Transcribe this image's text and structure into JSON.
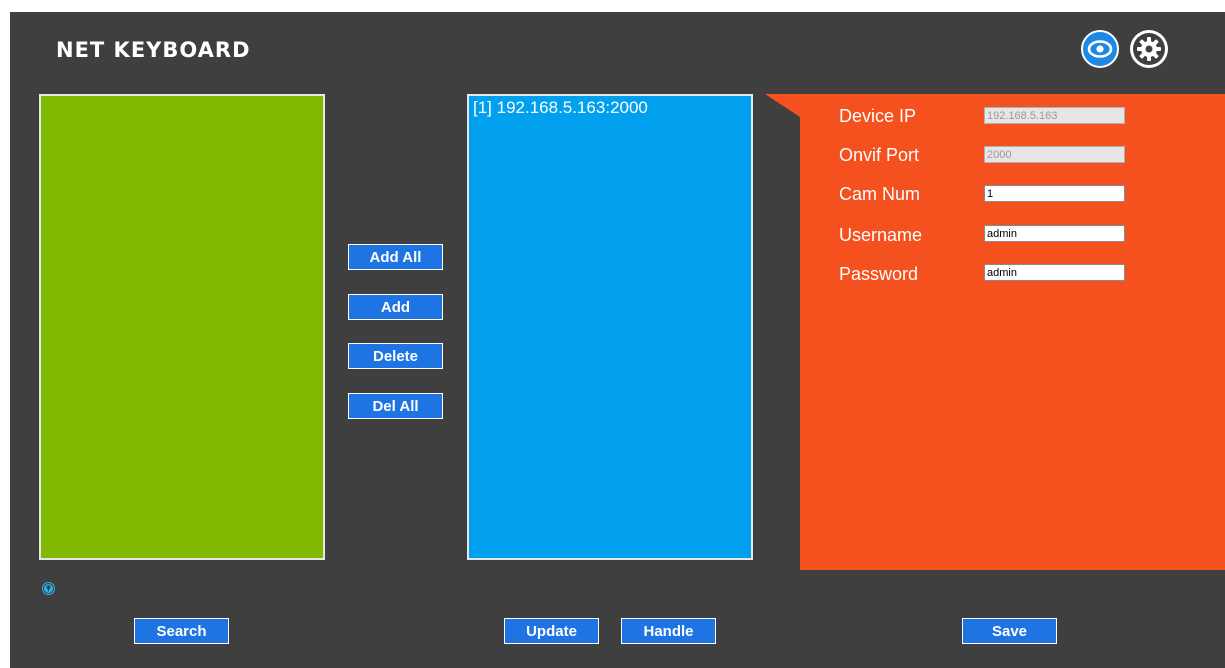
{
  "app": {
    "title": "NET KEYBOARD"
  },
  "icons": {
    "view": "eye-icon",
    "settings": "gear-icon",
    "info": "info-icon"
  },
  "camera_list": {
    "items": [
      {
        "label": "[1] 192.168.5.163:2000"
      }
    ]
  },
  "buttons": {
    "add_all": "Add All",
    "add": "Add",
    "delete": "Delete",
    "del_all": "Del All",
    "search": "Search",
    "update": "Update",
    "handle": "Handle",
    "save": "Save"
  },
  "device_form": {
    "device_ip": {
      "label": "Device IP",
      "value": "192.168.5.163"
    },
    "onvif_port": {
      "label": "Onvif Port",
      "value": "2000"
    },
    "cam_num": {
      "label": "Cam Num",
      "value": "1"
    },
    "username": {
      "label": "Username",
      "value": "admin"
    },
    "password": {
      "label": "Password",
      "value": "admin"
    }
  },
  "colors": {
    "background": "#3f3f3f",
    "search_panel": "#7fba00",
    "camera_panel": "#00a0ef",
    "settings_panel": "#f4511e",
    "button": "#1e74e2"
  }
}
